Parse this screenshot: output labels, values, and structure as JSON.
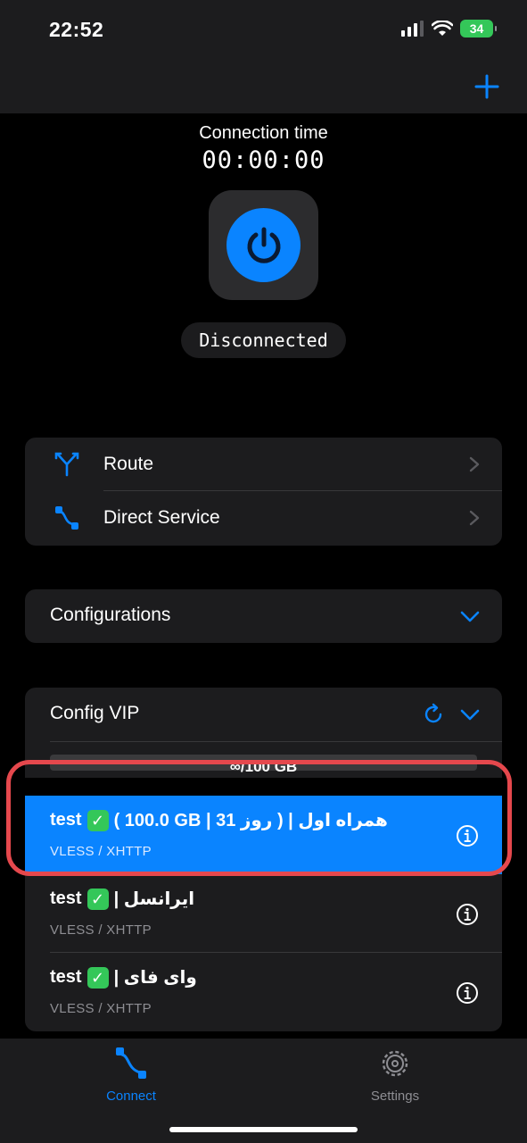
{
  "status_bar": {
    "time": "22:52",
    "battery": "34"
  },
  "connection": {
    "label": "Connection time",
    "timer": "00:00:00",
    "status": "Disconnected"
  },
  "menu": {
    "route": "Route",
    "direct_service": "Direct Service"
  },
  "configurations": {
    "label": "Configurations"
  },
  "config_vip": {
    "label": "Config VIP",
    "usage": "∞/100 GB",
    "servers": [
      {
        "name": "test",
        "suffix": "( 100.0 GB | 31 روز ) | همراه اول",
        "protocol": "VLESS / XHTTP",
        "selected": true
      },
      {
        "name": "test",
        "suffix": "| ایرانسل",
        "protocol": "VLESS / XHTTP",
        "selected": false
      },
      {
        "name": "test",
        "suffix": "| وای فای",
        "protocol": "VLESS / XHTTP",
        "selected": false
      }
    ]
  },
  "tabs": [
    {
      "label": "Connect",
      "active": true
    },
    {
      "label": "Settings",
      "active": false
    }
  ],
  "colors": {
    "accent": "#0a84ff",
    "highlight": "#e5484d",
    "check": "#34c759"
  },
  "icons": [
    "plus-icon",
    "power-icon",
    "route-icon",
    "direct-service-icon",
    "chevron-right-icon",
    "chevron-down-icon",
    "refresh-icon",
    "info-icon",
    "connect-tab-icon",
    "settings-tab-icon"
  ]
}
